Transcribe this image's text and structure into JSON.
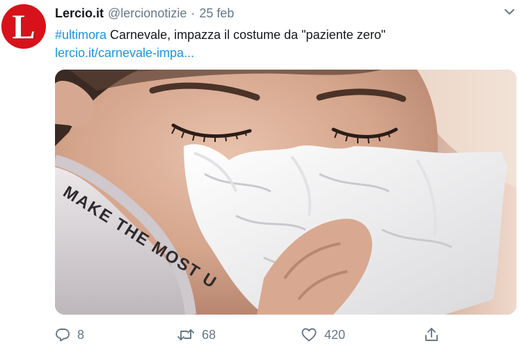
{
  "tweet": {
    "author_name": "Lercio.it",
    "handle": "@lercionotizie",
    "separator": "·",
    "date": "25 feb",
    "hashtag": "#ultimora",
    "text": "Carnevale, impazza il costume da \"paziente zero\"",
    "link": "lercio.it/carnevale-impa...",
    "avatar_letter": "L",
    "shirt_text": "MAKE THE MOST U",
    "brand_color": "#d7121a",
    "link_color": "#1b95e0"
  },
  "actions": {
    "reply": {
      "icon": "reply-icon",
      "count": "8"
    },
    "retweet": {
      "icon": "retweet-icon",
      "count": "68"
    },
    "like": {
      "icon": "heart-icon",
      "count": "420"
    },
    "share": {
      "icon": "share-icon"
    }
  },
  "menu": {
    "icon": "chevron-down-icon"
  }
}
